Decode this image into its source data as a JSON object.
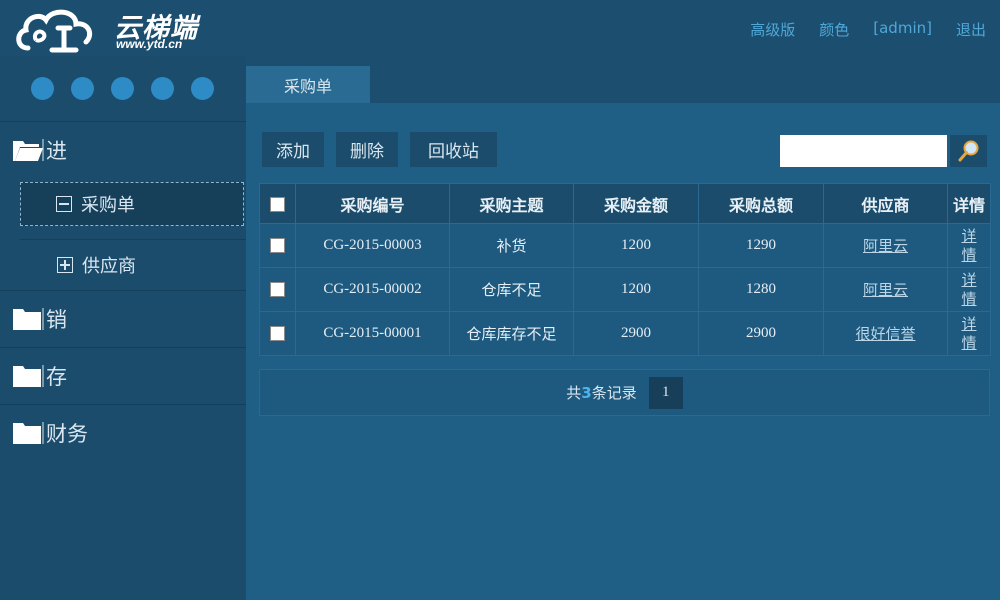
{
  "header": {
    "logo_name": "云梯端",
    "logo_url": "www.ytd.cn",
    "links": [
      "高级版",
      "颜色",
      "[admin]",
      "退出"
    ]
  },
  "sidebar": {
    "groups": [
      {
        "label": "进",
        "items": [
          {
            "label": "采购单",
            "active": true
          },
          {
            "label": "供应商",
            "active": false
          }
        ]
      },
      {
        "label": "销"
      },
      {
        "label": "存"
      },
      {
        "label": "财务"
      }
    ]
  },
  "main": {
    "tab": "采购单",
    "toolbar": {
      "add": "添加",
      "delete": "删除",
      "recycle": "回收站"
    },
    "search": {
      "placeholder": ""
    },
    "table": {
      "headers": [
        "采购编号",
        "采购主题",
        "采购金额",
        "采购总额",
        "供应商",
        "详情"
      ],
      "rows": [
        {
          "id": "CG-2015-00003",
          "subject": "补货",
          "amount": "1200",
          "total": "1290",
          "supplier": "阿里云",
          "detail": "详情"
        },
        {
          "id": "CG-2015-00002",
          "subject": "仓库不足",
          "amount": "1200",
          "total": "1280",
          "supplier": "阿里云",
          "detail": "详情"
        },
        {
          "id": "CG-2015-00001",
          "subject": "仓库库存不足",
          "amount": "2900",
          "total": "2900",
          "supplier": "很好信誉",
          "detail": "详情"
        }
      ]
    },
    "pager": {
      "prefix": "共",
      "count": "3",
      "suffix": "条记录",
      "page": "1"
    }
  },
  "colors": {
    "accent": "#2d8bc6",
    "link": "#4fa8d8",
    "background": "#1f5f86",
    "panel": "#1b4c6b"
  }
}
